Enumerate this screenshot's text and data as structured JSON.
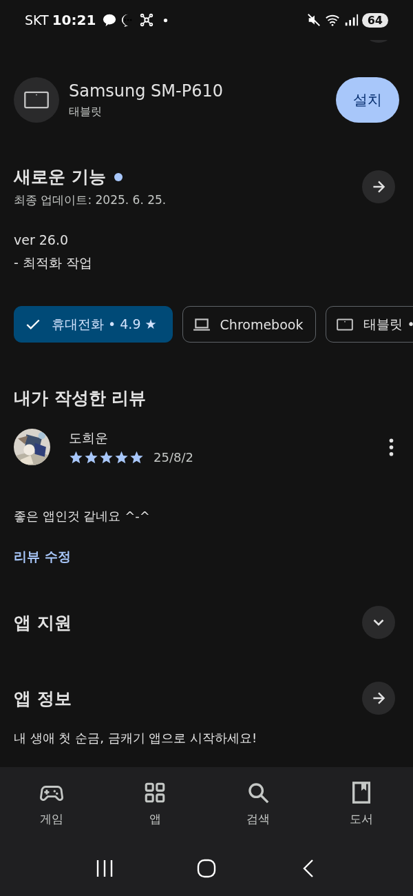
{
  "status_bar": {
    "carrier": "SKT",
    "time": "10:21",
    "battery": "64"
  },
  "device": {
    "name": "Samsung SM-P610",
    "type": "태블릿",
    "button": "설치"
  },
  "whats_new": {
    "title": "새로운 기능",
    "new": true,
    "updated": "최종 업데이트: 2025. 6. 25.",
    "lines": [
      "ver 26.0",
      "- 최적화 작업"
    ]
  },
  "chips": [
    {
      "kind": "check",
      "label": "휴대전화 • 4.9 ★",
      "selected": true
    },
    {
      "kind": "laptop",
      "label": "Chromebook",
      "selected": false
    },
    {
      "kind": "tablet",
      "label": "태블릿 •",
      "selected": false
    }
  ],
  "my_review": {
    "title": "내가 작성한 리뷰",
    "author": "도희운",
    "stars": 5,
    "date": "25/8/2",
    "text": "좋은 앱인것 같네요 ^-^",
    "edit_link": "리뷰 수정"
  },
  "sections": [
    {
      "kind": "expand",
      "title": "앱 지원"
    },
    {
      "kind": "arrow",
      "title": "앱 정보",
      "subtitle": "내 생애 첫 순금, 금캐기 앱으로 시작하세요!"
    }
  ],
  "bottom_nav": [
    {
      "kind": "games",
      "label": "게임",
      "selected": false
    },
    {
      "kind": "apps",
      "label": "앱",
      "selected": false
    },
    {
      "kind": "search",
      "label": "검색",
      "selected": false
    },
    {
      "kind": "books",
      "label": "도서",
      "selected": false
    }
  ]
}
